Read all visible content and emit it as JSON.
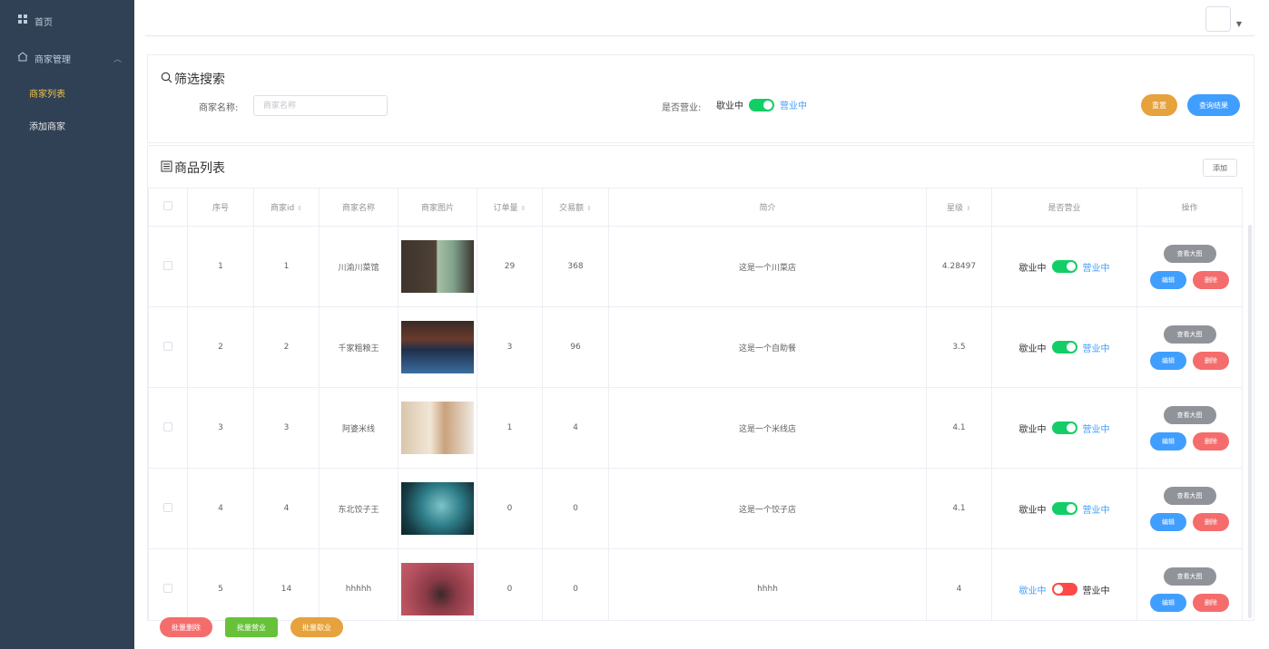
{
  "sidebar": {
    "home_label": "首页",
    "group_label": "商家管理",
    "items": [
      {
        "label": "商家列表",
        "active": true
      },
      {
        "label": "添加商家",
        "active": false
      }
    ]
  },
  "filter": {
    "title": "筛选搜索",
    "name_label": "商家名称:",
    "name_placeholder": "商家名称",
    "name_value": "",
    "status_label": "是否营业:",
    "off_text": "歇业中",
    "on_text": "营业中",
    "status_on": true,
    "reset_label": "重置",
    "search_label": "查询结果"
  },
  "list": {
    "title": "商品列表",
    "add_label": "添加",
    "columns": [
      "序号",
      "商家id",
      "商家名称",
      "商家图片",
      "订单量",
      "交易额",
      "简介",
      "星级",
      "是否营业",
      "操作"
    ],
    "rows": [
      {
        "index": "1",
        "id": "1",
        "name": "川渝川菜馆",
        "orders": "29",
        "amount": "368",
        "intro": "这是一个川菜店",
        "stars": "4.28497",
        "open": true
      },
      {
        "index": "2",
        "id": "2",
        "name": "千家粗粮王",
        "orders": "3",
        "amount": "96",
        "intro": "这是一个自助餐",
        "stars": "3.5",
        "open": true
      },
      {
        "index": "3",
        "id": "3",
        "name": "阿婆米线",
        "orders": "1",
        "amount": "4",
        "intro": "这是一个米线店",
        "stars": "4.1",
        "open": true
      },
      {
        "index": "4",
        "id": "4",
        "name": "东北饺子王",
        "orders": "0",
        "amount": "0",
        "intro": "这是一个饺子店",
        "stars": "4.1",
        "open": true
      },
      {
        "index": "5",
        "id": "14",
        "name": "hhhhh",
        "orders": "0",
        "amount": "0",
        "intro": "hhhh",
        "stars": "4",
        "open": false
      }
    ],
    "row_off_text": "歇业中",
    "row_on_text": "营业中",
    "view_label": "查看大图",
    "edit_label": "编辑",
    "delete_label": "删除"
  },
  "bulk": {
    "delete_label": "批量删除",
    "open_label": "批量营业",
    "close_label": "批量歇业"
  },
  "colors": {
    "sidebar_bg": "#304156",
    "active_menu": "#f0c24b",
    "switch_on": "#13ce66",
    "switch_off": "#ff4949",
    "primary": "#409eff",
    "warning": "#e6a23c",
    "danger": "#f56c6c",
    "success": "#67c23a",
    "info": "#909399"
  },
  "icons": {
    "home": "grid-icon",
    "group": "house-icon",
    "filter": "search-icon",
    "list": "list-icon"
  }
}
